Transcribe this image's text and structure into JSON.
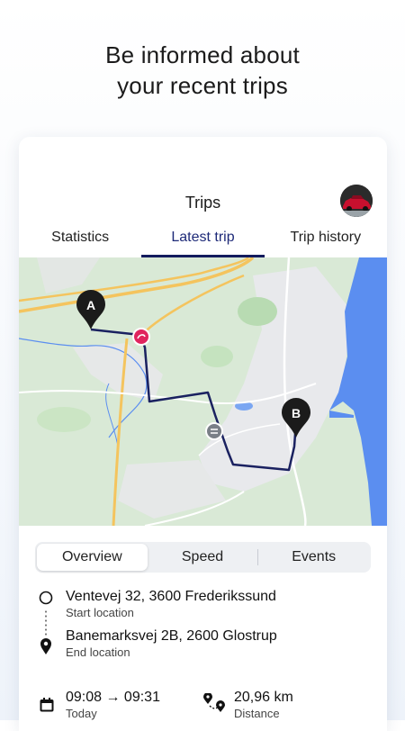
{
  "headline": {
    "line1": "Be informed about",
    "line2": "your recent trips"
  },
  "screen": {
    "title": "Trips"
  },
  "tabs": [
    {
      "label": "Statistics",
      "active": false
    },
    {
      "label": "Latest trip",
      "active": true
    },
    {
      "label": "Trip history",
      "active": false
    }
  ],
  "map": {
    "start_marker": "A",
    "end_marker": "B"
  },
  "segments": [
    {
      "label": "Overview",
      "active": true
    },
    {
      "label": "Speed",
      "active": false
    },
    {
      "label": "Events",
      "active": false
    }
  ],
  "trip": {
    "start": {
      "address": "Ventevej 32, 3600 Frederikssund",
      "label": "Start location"
    },
    "end": {
      "address": "Banemarksvej 2B, 2600 Glostrup",
      "label": "End location"
    },
    "time": {
      "value": "09:08 → 09:31",
      "label": "Today"
    },
    "distance": {
      "value": "20,96 km",
      "label": "Distance"
    }
  },
  "colors": {
    "accent": "#131b5e",
    "route": "#1a2160",
    "water": "#5b8ef0",
    "map_land": "#d9e9d6",
    "road_major": "#f4c45e",
    "harsh_event": "#e0245e"
  }
}
